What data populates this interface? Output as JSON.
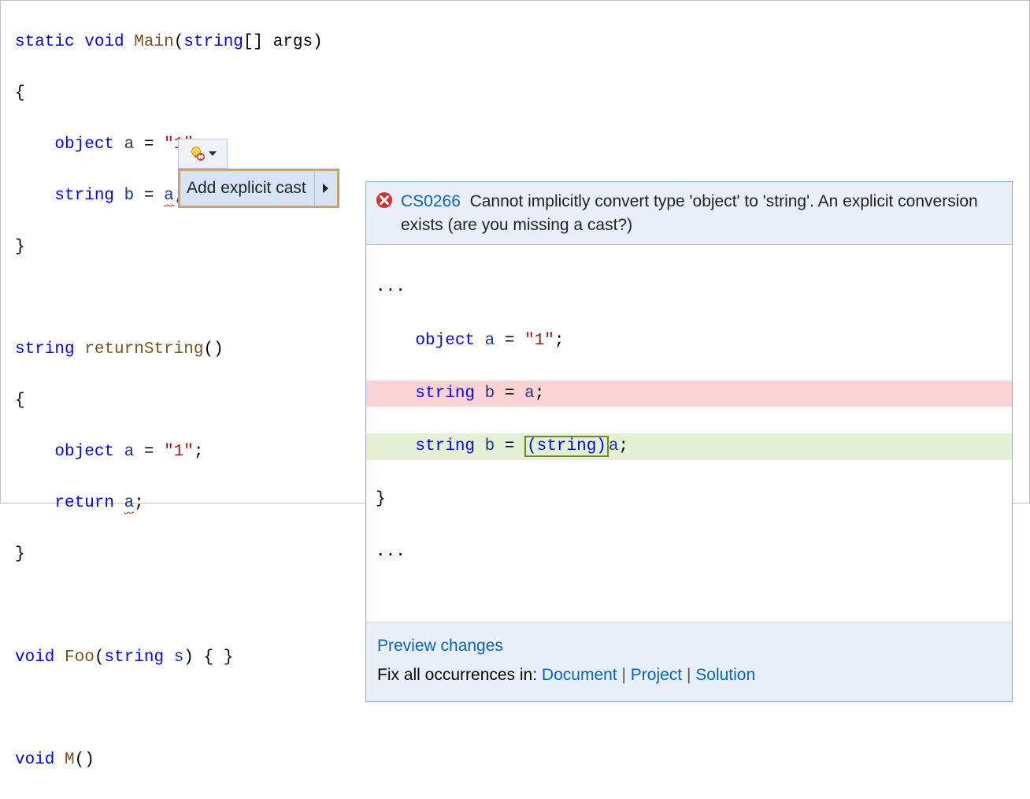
{
  "code": {
    "line1": {
      "kw1": "static",
      "kw2": "void",
      "method": "Main",
      "kw3": "string",
      "rest": "[] args)"
    },
    "line2": "{",
    "line3": {
      "kw": "object",
      "ident": "a",
      "eq": " = ",
      "str": "\"1\"",
      "semi": ";"
    },
    "line4": {
      "kw": "string",
      "ident": "b",
      "eq": " = ",
      "rhs": "a",
      "semi": ";"
    },
    "line5": "}",
    "line7": {
      "kw": "string",
      "method": "returnString",
      "rest": "()"
    },
    "line8": "{",
    "line9": {
      "kw": "object",
      "ident": "a",
      "eq": " = ",
      "str": "\"1\"",
      "semi": ";"
    },
    "line10": {
      "kw": "return",
      "rhs": "a",
      "semi": ";"
    },
    "line11": "}",
    "line13": {
      "kw1": "void",
      "method": "Foo",
      "kw2": "string",
      "ident": "s",
      "rest": ") { }"
    },
    "line15": {
      "kw": "void",
      "method": "M",
      "rest": "()"
    }
  },
  "quickAction": {
    "label": "Add explicit cast"
  },
  "error": {
    "code": "CS0266",
    "message": "Cannot implicitly convert type 'object' to 'string'. An explicit conversion exists (are you missing a cast?)"
  },
  "diff": {
    "dots": "...",
    "context1": {
      "kw": "object",
      "ident": "a",
      "eq": " = ",
      "str": "\"1\"",
      "semi": ";"
    },
    "removed": {
      "kw": "string",
      "ident": "b",
      "eq": " = ",
      "rhs": "a",
      "semi": ";"
    },
    "added": {
      "kw": "string",
      "ident": "b",
      "eq": " = ",
      "cast": "(string)",
      "rhs": "a",
      "semi": ";"
    },
    "context2": "}"
  },
  "footer": {
    "previewChanges": "Preview changes",
    "fixLabel": "Fix all occurrences in:",
    "document": "Document",
    "project": "Project",
    "solution": "Solution"
  }
}
